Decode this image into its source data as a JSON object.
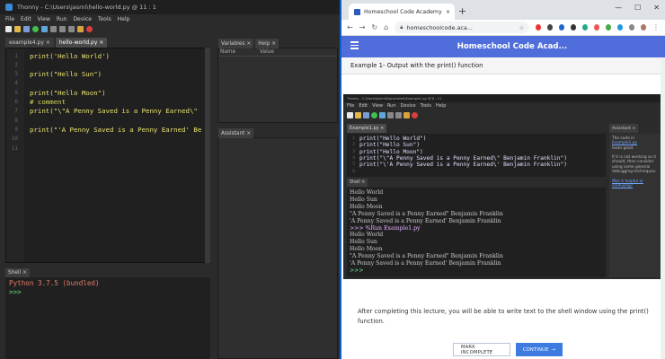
{
  "thonny": {
    "window_title": "Thonny  -  C:\\Users\\jasmi\\hello-world.py  @  11 : 1",
    "menu": [
      "File",
      "Edit",
      "View",
      "Run",
      "Device",
      "Tools",
      "Help"
    ],
    "tabs": [
      {
        "label": "example4.py ×"
      },
      {
        "label": "hello-world.py ×"
      }
    ],
    "code_lines": [
      {
        "num": "1",
        "text": "print('Hello World')",
        "kind": "code"
      },
      {
        "num": "2",
        "text": "",
        "kind": "code"
      },
      {
        "num": "3",
        "text": "print(\"Hello Sun\")",
        "kind": "code"
      },
      {
        "num": "4",
        "text": "",
        "kind": "code"
      },
      {
        "num": "5",
        "text": "print(\"Hello Moon\")",
        "kind": "code"
      },
      {
        "num": "6",
        "text": "# comment",
        "kind": "comment"
      },
      {
        "num": "7",
        "text": "print(\"\\\"A Penny Saved is a Penny Earned\\\"",
        "kind": "code"
      },
      {
        "num": "8",
        "text": "",
        "kind": "code"
      },
      {
        "num": "9",
        "text": "print(\"'A Penny Saved is a Penny Earned' Be",
        "kind": "code"
      },
      {
        "num": "10",
        "text": "",
        "kind": "code"
      },
      {
        "num": "11",
        "text": "",
        "kind": "code"
      }
    ],
    "variables_tab": "Variables ×",
    "help_tab": "Help ×",
    "var_name_col": "Name",
    "var_value_col": "Value",
    "assistant_tab": "Assistant ×",
    "shell_tab": "Shell ×",
    "shell_lines": [
      {
        "text": "Python 3.7.5 (bundled)",
        "color": "#e07a6a"
      },
      {
        "text": ">>>",
        "color": "#6ae08f"
      }
    ]
  },
  "browser": {
    "tab_title": "Homeschool Code Academy",
    "tab_close": "×",
    "new_tab": "+",
    "url": "homeschoolcode.aca...",
    "site_title": "Homeschool Code Acad...",
    "lesson_title": "Example 1- Output with the print() function",
    "paragraph": "After completing this lecture, you will be able to write text to the shell window using the print() function.",
    "mark_incomplete": "MARK INCOMPLETE",
    "continue": "CONTINUE",
    "continue_arrow": "→",
    "window_controls": [
      "—",
      "☐",
      "✕"
    ]
  },
  "embedded": {
    "title": "Thonny - C:\\Users\\jasmi\\Documents\\Example1.py @ 8 : 11",
    "menu": [
      "File",
      "Edit",
      "View",
      "Run",
      "Device",
      "Tools",
      "Help"
    ],
    "tab": "Example1.py ×",
    "code_lines": [
      {
        "num": "1",
        "text": "print(\"Hello World\")"
      },
      {
        "num": "2",
        "text": "print(\"Hello Sun\")"
      },
      {
        "num": "3",
        "text": "print(\"Hello Moon\")"
      },
      {
        "num": "4",
        "text": "print(\"\\\"A Penny Saved is a Penny Earned\\\" Benjamin Franklin\")"
      },
      {
        "num": "5",
        "text": "print(\"\\'A Penny Saved is a Penny Earned\\' Benjamin Franklin\")"
      },
      {
        "num": "6",
        "text": ""
      }
    ],
    "assistant_tab": "Assistant ×",
    "assistant_lines": [
      {
        "text": "The code in",
        "link": false
      },
      {
        "text": "Example1.py",
        "link": true
      },
      {
        "text": "looks good.",
        "link": false
      },
      {
        "text": "",
        "link": false
      },
      {
        "text": "If it is not working as it",
        "link": false
      },
      {
        "text": "should, then consider",
        "link": false
      },
      {
        "text": "using some general",
        "link": false
      },
      {
        "text": "debugging techniques.",
        "link": false
      },
      {
        "text": "",
        "link": false
      },
      {
        "text": "Was it helpful or",
        "link": true
      },
      {
        "text": "confusing?",
        "link": true
      }
    ],
    "shell_tab": "Shell ×",
    "shell_lines": [
      {
        "text": "Hello World",
        "color": "#c8c8c8"
      },
      {
        "text": "Hello Sun",
        "color": "#c8c8c8"
      },
      {
        "text": "Hello Moon",
        "color": "#c8c8c8"
      },
      {
        "text": "\"A Penny Saved is a Penny Earned\" Benjamin Franklin",
        "color": "#c8c8c8"
      },
      {
        "text": "'A Penny Saved is a Penny Earned' Benjamin Franklin",
        "color": "#c8c8c8"
      },
      {
        "text": ">>> %Run Example1.py",
        "color": "#e6b3ff"
      },
      {
        "text": "Hello World",
        "color": "#c8c8c8"
      },
      {
        "text": "Hello Sun",
        "color": "#c8c8c8"
      },
      {
        "text": "Hello Moon",
        "color": "#c8c8c8"
      },
      {
        "text": "\"A Penny Saved is a Penny Earned\" Benjamin Franklin",
        "color": "#c8c8c8"
      },
      {
        "text": "'A Penny Saved is a Penny Earned' Benjamin Franklin",
        "color": "#c8c8c8"
      },
      {
        "text": ">>>",
        "color": "#6ae08f"
      }
    ]
  },
  "colors": {
    "brand_blue": "#4f6ddb",
    "primary_button": "#3d7be0",
    "code_yellow": "#e8e070"
  }
}
